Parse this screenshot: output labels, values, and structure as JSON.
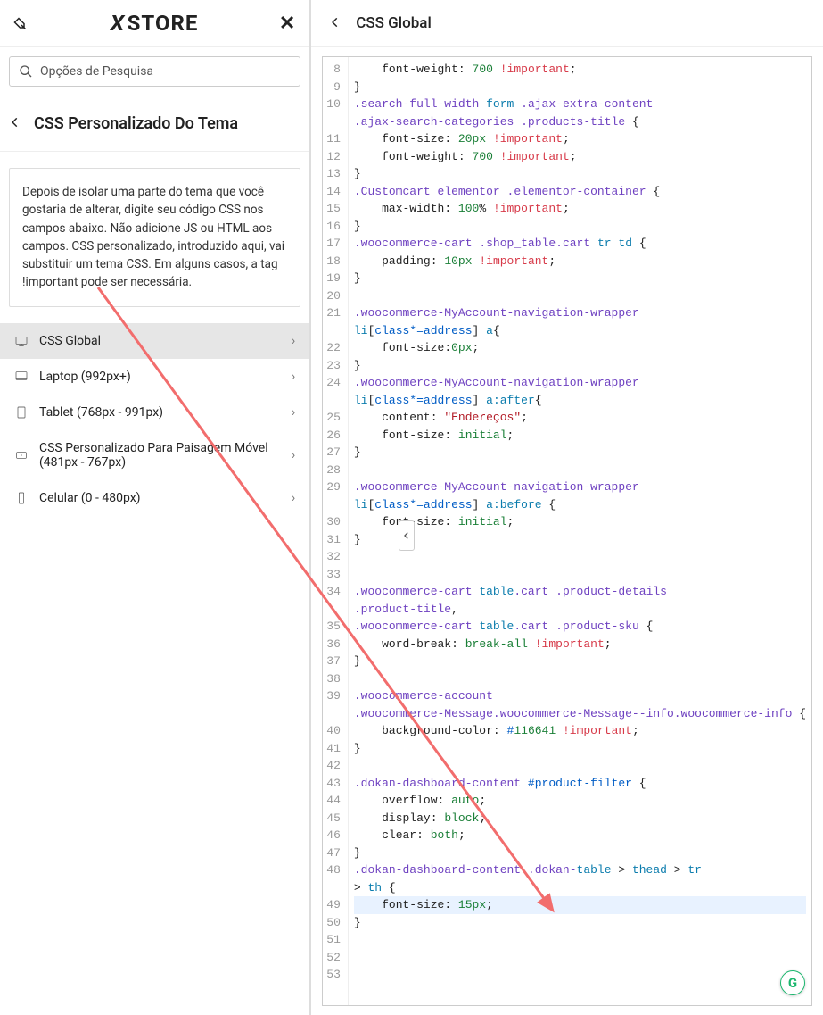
{
  "left": {
    "logo": "XSTORE",
    "search_placeholder": "Opções de Pesquisa",
    "section_title": "CSS Personalizado Do Tema",
    "description": "Depois de isolar uma parte do tema que você gostaria de alterar, digite seu código CSS nos campos abaixo. Não adicione JS ou HTML aos campos. CSS personalizado, introduzido aqui, vai substituir um tema CSS. Em alguns casos, a tag !important pode ser necessária.",
    "menu": [
      {
        "label": "CSS Global",
        "active": true
      },
      {
        "label": "Laptop (992px+)",
        "active": false
      },
      {
        "label": "Tablet (768px - 991px)",
        "active": false
      },
      {
        "label": "CSS Personalizado Para Paisagem Móvel (481px - 767px)",
        "active": false
      },
      {
        "label": "Celular (0 - 480px)",
        "active": false
      }
    ]
  },
  "right": {
    "title": "CSS Global",
    "first_line_no": 8,
    "lines": [
      "    font-weight: 700 !important;",
      "}",
      ".search-full-width form .ajax-extra-content .ajax-search-categories .products-title {",
      "    font-size: 20px !important;",
      "    font-weight: 700 !important;",
      "}",
      ".Customcart_elementor .elementor-container {",
      "    max-width: 100% !important;",
      "}",
      ".woocommerce-cart .shop_table.cart tr td {",
      "    padding: 10px !important;",
      "}",
      "",
      ".woocommerce-MyAccount-navigation-wrapper li[class*=address] a{",
      "    font-size:0px;",
      "}",
      ".woocommerce-MyAccount-navigation-wrapper li[class*=address] a:after{",
      "    content: \"Endereços\";",
      "    font-size: initial;",
      "}",
      "",
      ".woocommerce-MyAccount-navigation-wrapper li[class*=address] a:before {",
      "    font-size: initial;",
      "}",
      "",
      "",
      ".woocommerce-cart table.cart .product-details .product-title,",
      ".woocommerce-cart table.cart .product-sku {",
      "    word-break: break-all !important;",
      "}",
      "",
      ".woocommerce-account .woocommerce-Message.woocommerce-Message--info.woocommerce-info {",
      "    background-color: #116641 !important;",
      "}",
      "",
      ".dokan-dashboard-content #product-filter {",
      "    overflow: auto;",
      "    display: block;",
      "    clear: both;",
      "}",
      ".dokan-dashboard-content .dokan-table > thead > tr > th {",
      "    font-size: 15px;",
      "}",
      "",
      "",
      ""
    ],
    "highlight_line_no": 49
  },
  "badge": "G"
}
